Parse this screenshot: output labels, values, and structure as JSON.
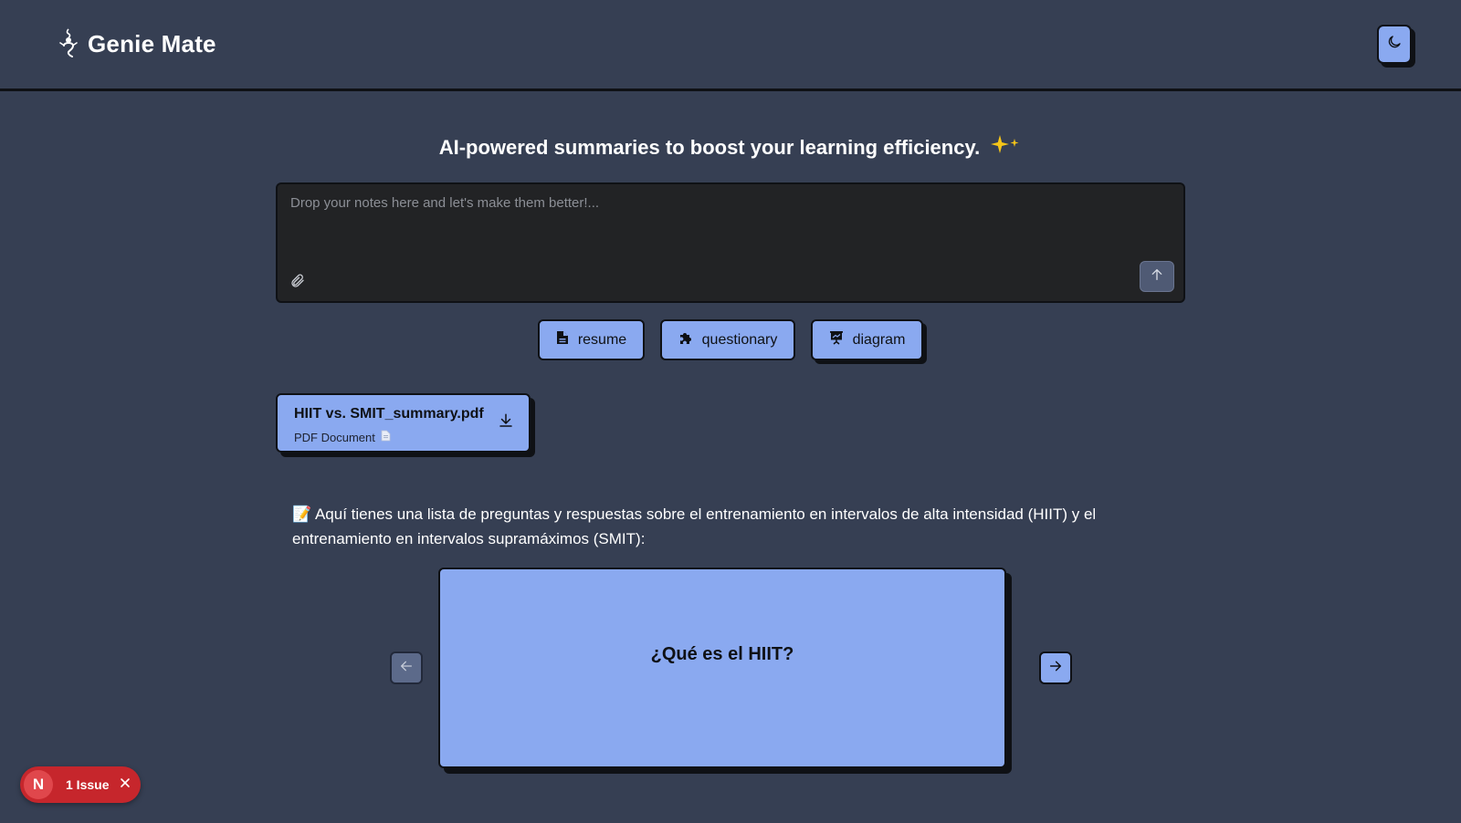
{
  "app": {
    "name": "Genie Mate"
  },
  "colors": {
    "background": "#363f53",
    "accent": "#8aa9f0",
    "border": "#0f1115",
    "input_bg": "#222325",
    "issue_red": "#c6262c",
    "sparkle": "#f5c518"
  },
  "header": {
    "logo_icon": "genie-lamp-icon",
    "theme_toggle_icon": "moon-icon"
  },
  "hero": {
    "tagline": "AI-powered summaries to boost your learning efficiency.",
    "tagline_icon": "sparkles-icon"
  },
  "composer": {
    "placeholder": "Drop your notes here and let's make them better!...",
    "value": "",
    "attach_icon": "paperclip-icon",
    "send_icon": "arrow-up-icon"
  },
  "actions": [
    {
      "label": "resume",
      "icon": "file-icon"
    },
    {
      "label": "questionary",
      "icon": "puzzle-icon"
    },
    {
      "label": "diagram",
      "icon": "presentation-icon"
    }
  ],
  "file": {
    "name": "HIIT vs. SMIT_summary.pdf",
    "type": "PDF Document",
    "type_icon": "document-icon",
    "download_icon": "download-icon"
  },
  "response": {
    "emoji": "📝",
    "intro": "Aquí tienes una lista de preguntas y respuestas sobre el entrenamiento en intervalos de alta intensidad (HIIT) y el entrenamiento en intervalos supramáximos (SMIT):"
  },
  "flashcard": {
    "question": "¿Qué es el HIIT?",
    "prev_icon": "arrow-left-icon",
    "next_icon": "arrow-right-icon"
  },
  "dev_overlay": {
    "logo_letter": "N",
    "issue_label": "1 Issue",
    "close_icon": "close-icon"
  }
}
